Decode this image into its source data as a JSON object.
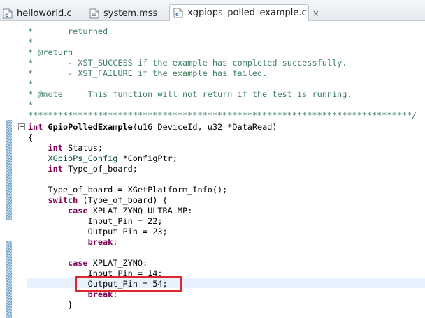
{
  "tabs": [
    {
      "label": "helloworld.c",
      "icon": "c-file-icon",
      "active": false
    },
    {
      "label": "system.mss",
      "icon": "mss-file-icon",
      "active": false
    },
    {
      "label": "xgpiops_polled_example.c",
      "icon": "c-file-icon",
      "active": true,
      "close": "×"
    }
  ],
  "colors": {
    "comment": "#3f7f5f",
    "keyword": "#7f0055",
    "type": "#005032",
    "current_line": "#e8f2fe",
    "highlight_box": "#e0262b"
  },
  "code": {
    "l01": [
      "*       returned."
    ],
    "l02": [
      "*"
    ],
    "l03": [
      "* @return"
    ],
    "l04": [
      "*       - XST_SUCCESS if the example has completed successfully."
    ],
    "l05": [
      "*       - XST_FAILURE if the example has failed."
    ],
    "l06": [
      "*"
    ],
    "l07": [
      "* @note     This function will not return if the test is running."
    ],
    "l08": [
      "*"
    ],
    "l09": [
      "*****************************************************************************/"
    ],
    "l10": [
      "int",
      " ",
      "GpioPolledExample",
      "(u16 DeviceId, u32 *DataRead)"
    ],
    "l11": [
      "{"
    ],
    "l12": [
      "    ",
      "int",
      " Status;"
    ],
    "l13": [
      "    ",
      "XGpioPs_Config",
      " *ConfigPtr;"
    ],
    "l14": [
      "    ",
      "int",
      " Type_of_board;"
    ],
    "l15": [
      ""
    ],
    "l16": [
      "    Type_of_board = XGetPlatform_Info();"
    ],
    "l17": [
      "    ",
      "switch",
      " (Type_of_board) {"
    ],
    "l18": [
      "        ",
      "case",
      " XPLAT_ZYNQ_ULTRA_MP:"
    ],
    "l19": [
      "            Input_Pin = 22;"
    ],
    "l20": [
      "            Output_Pin = 23;"
    ],
    "l21": [
      "            ",
      "break",
      ";"
    ],
    "l22": [
      ""
    ],
    "l23": [
      "        ",
      "case",
      " XPLAT_ZYNQ:"
    ],
    "l24": [
      "            Input_Pin = 14;"
    ],
    "l25": [
      "            Output_Pin = 54;"
    ],
    "l26": [
      "            ",
      "break",
      ";"
    ],
    "l27": [
      "        }"
    ]
  }
}
